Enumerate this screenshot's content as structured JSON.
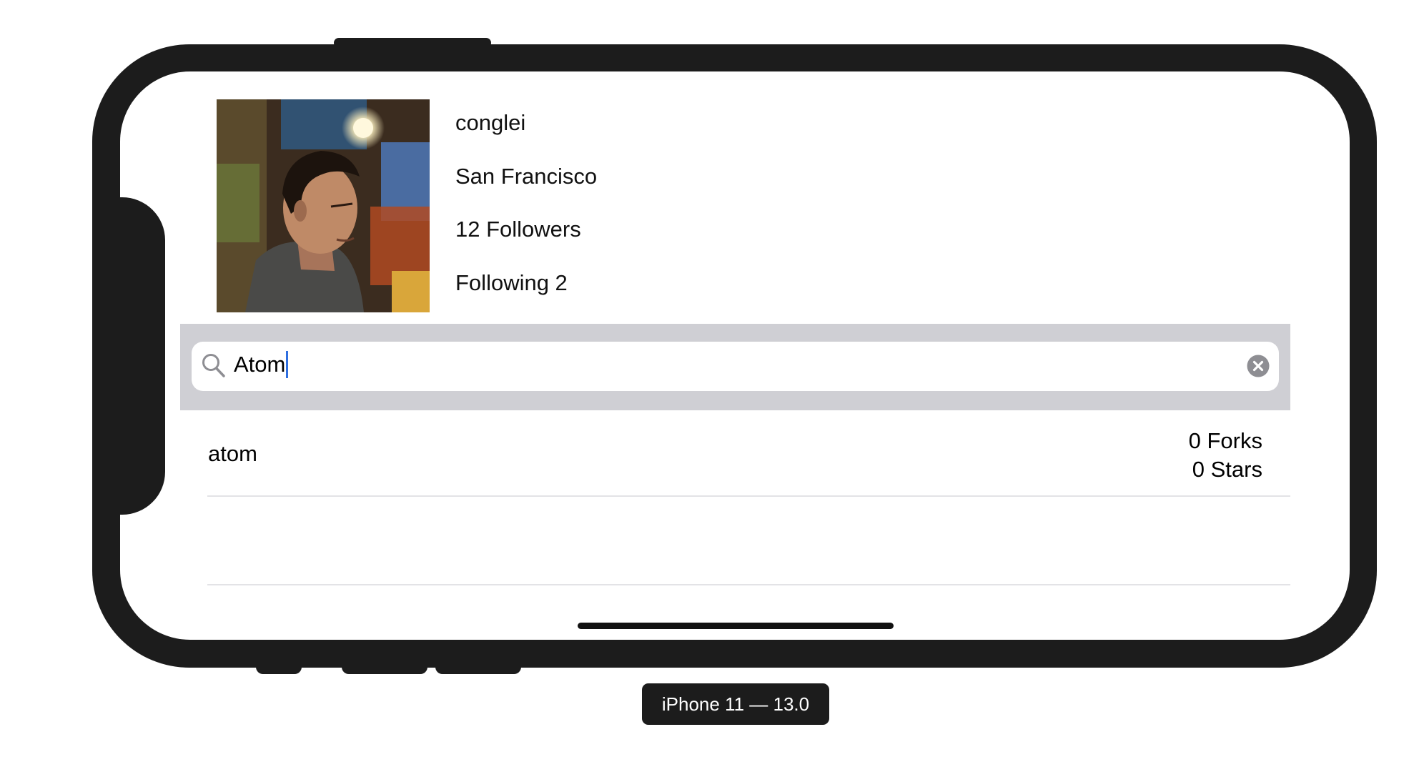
{
  "profile": {
    "username": "conglei",
    "location": "San Francisco",
    "followers": "12 Followers",
    "following": "Following 2"
  },
  "search": {
    "value": "Atom"
  },
  "results": [
    {
      "name": "atom",
      "forks": "0 Forks",
      "stars": "0 Stars"
    }
  ],
  "device": {
    "label": "iPhone 11 — 13.0"
  },
  "icons": {
    "search": "magnifying-glass",
    "clear": "x-circle-fill",
    "avatar": "profile-photo"
  },
  "colors": {
    "search_bar_background": "#cfcfd4",
    "caret": "#2f6fe0",
    "device_frame": "#1c1c1c"
  }
}
